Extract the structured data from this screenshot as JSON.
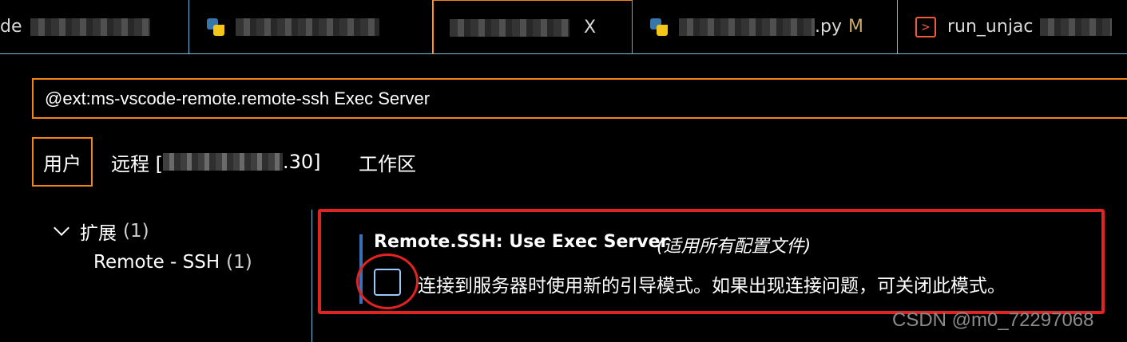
{
  "tabs": [
    {
      "label": "de",
      "redacted": true,
      "icon": "none"
    },
    {
      "label": "",
      "redacted": true,
      "icon": "python-icon"
    },
    {
      "label": "",
      "redacted": true,
      "icon": "none",
      "close": "X"
    },
    {
      "label": ".py",
      "redacted": true,
      "icon": "python-icon",
      "modified": "M"
    },
    {
      "label": "run_unjac",
      "redacted": true,
      "icon": "terminal-icon"
    }
  ],
  "search": {
    "value": "@ext:ms-vscode-remote.remote-ssh Exec Server"
  },
  "scope_tabs": {
    "user": "用户",
    "remote_prefix": "远程 [",
    "remote_suffix": ".30]",
    "workspace": "工作区"
  },
  "toc": {
    "extensions_label": "扩展",
    "extensions_count": "(1)",
    "remote_ssh_label": "Remote - SSH",
    "remote_ssh_count": "(1)"
  },
  "setting": {
    "title": "Remote.SSH: Use Exec Server",
    "scope": "(适用所有配置文件)",
    "checked": false,
    "description": "连接到服务器时使用新的引导模式。如果出现连接问题，可关闭此模式。"
  },
  "watermark": "CSDN @m0_72297068",
  "colors": {
    "focus_border": "#f38518",
    "contrast_border": "#6fc3df",
    "annotation_red": "#e32222",
    "checkbox_border": "#9ac8ff",
    "setting_bar": "#3b6fb6"
  }
}
